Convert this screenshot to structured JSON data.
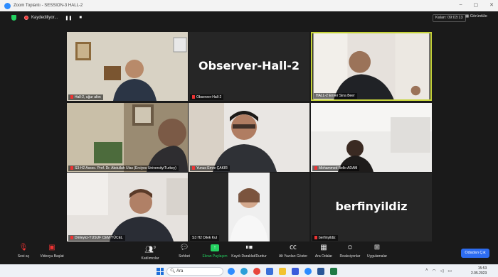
{
  "window": {
    "title": "Zoom Toplantı - SESSION-3 HALL-2",
    "controls": [
      "–",
      "▢",
      "✕"
    ]
  },
  "topbar": {
    "recording_label": "Kaydediliyor...",
    "pause_glyph": "❚❚",
    "stop_glyph": "■",
    "timer": "Kalan: 09:03:13",
    "view_label": "Görüntüle"
  },
  "tiles": [
    {
      "name": "Hall-2, uğur altın",
      "big": ""
    },
    {
      "name": "Observer-Hall-2",
      "big": "Observer-Hall-2"
    },
    {
      "name": "HALL-2 Enver Sina Beer",
      "big": ""
    },
    {
      "name": "S3-H2 Assoc. Prof. Dr. Abdullah Ulas (Erciyes University/Turkey)",
      "big": ""
    },
    {
      "name": "Yunus Emre ÇAKIR",
      "big": ""
    },
    {
      "name": "Mohammed Bello ADAM",
      "big": ""
    },
    {
      "name": "Dinleyici-YUSUF CEM YÜCEL",
      "big": ""
    },
    {
      "name": "S3 H2 Dilek Kul",
      "big": ""
    },
    {
      "name": "berfinyildiz",
      "big": "berfinyildiz"
    }
  ],
  "toolbar": {
    "unmute": "Sesi aç",
    "video": "Videoyu Başlat",
    "participants": "Katılımcılar",
    "participants_count": "9",
    "chat": "Sohbet",
    "share": "Ekran Paylaşım",
    "record": "Kaydı Duraklat/Durdur",
    "cc": "Alt Yazıları Göster",
    "breakout": "Ara Odalar",
    "reactions": "Reaksiyonlar",
    "apps": "Uygulamalar",
    "leave": "Odadan Çık"
  },
  "taskbar": {
    "search_placeholder": "Ara",
    "time": "15:53",
    "date": "2.05.2023"
  },
  "colors": {
    "accent": "#2d8cff",
    "active_speaker": "#c6d33a",
    "share_green": "#23d160",
    "leave_blue": "#2d6cf0"
  }
}
